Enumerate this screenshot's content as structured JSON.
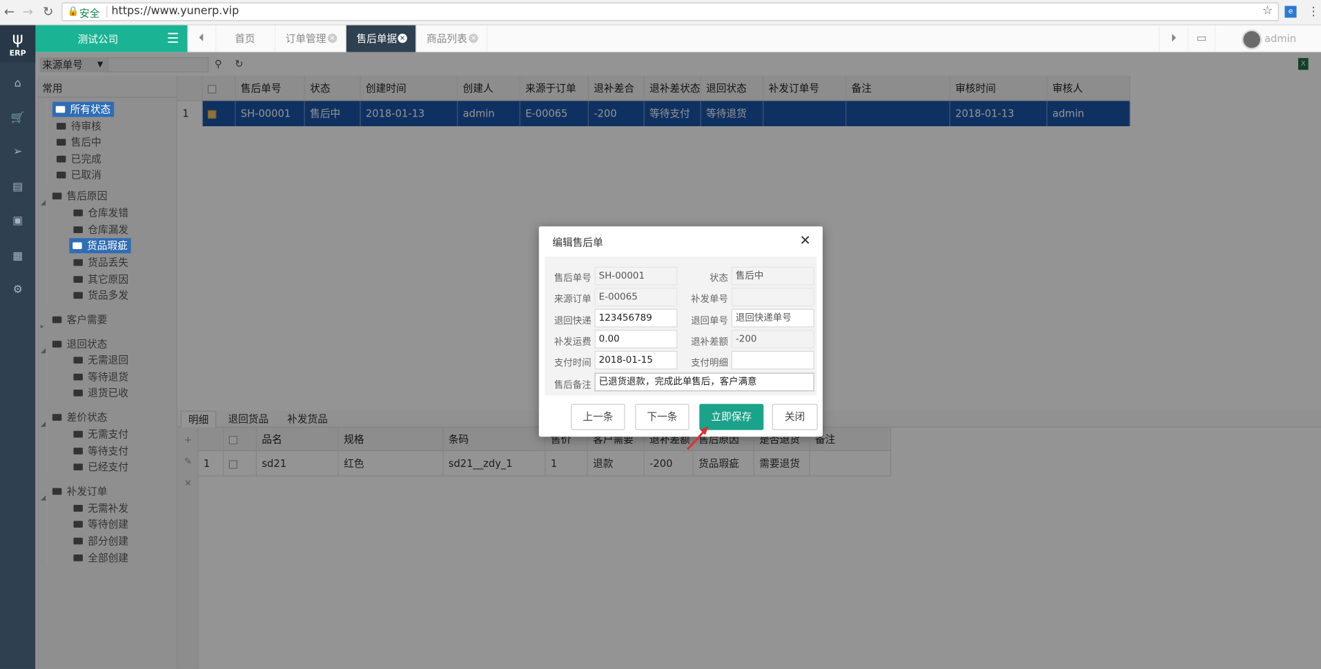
{
  "browser": {
    "secure_label": "安全",
    "url": "https://www.yunerp.vip"
  },
  "app": {
    "logo_text": "ERP",
    "company": "测试公司",
    "user": "admin"
  },
  "tabs": [
    {
      "label": "首页"
    },
    {
      "label": "订单管理"
    },
    {
      "label": "售后单据",
      "active": true
    },
    {
      "label": "商品列表"
    }
  ],
  "filter": {
    "select_value": "来源单号"
  },
  "tree": {
    "header": "常用",
    "groups": [
      {
        "label": "所有状态",
        "children": [
          "待审核",
          "售后中",
          "已完成",
          "已取消"
        ]
      },
      {
        "label": "售后原因",
        "children": [
          "仓库发错",
          "仓库漏发",
          "货品瑕疵",
          "货品丢失",
          "其它原因",
          "货品多发"
        ]
      },
      {
        "label": "客户需要",
        "children": []
      },
      {
        "label": "退回状态",
        "children": [
          "无需退回",
          "等待退货",
          "退货已收"
        ]
      },
      {
        "label": "差价状态",
        "children": [
          "无需支付",
          "等待支付",
          "已经支付"
        ]
      },
      {
        "label": "补发订单",
        "children": [
          "无需补发",
          "等待创建",
          "部分创建",
          "全部创建"
        ]
      }
    ]
  },
  "grid": {
    "columns": [
      "售后单号",
      "状态",
      "创建时间",
      "创建人",
      "来源于订单",
      "退补差合计",
      "退补差状态",
      "退回状态",
      "补发订单号",
      "备注",
      "审核时间",
      "审核人"
    ],
    "row": {
      "no": "1",
      "cells": [
        "SH-00001",
        "售后中",
        "2018-01-13 14:36:09",
        "admin",
        "E-00065",
        "-200",
        "等待支付",
        "等待退货",
        "",
        "",
        "2018-01-13 14:36:09",
        "admin"
      ]
    }
  },
  "bottom_tabs": [
    "明细",
    "退回货品",
    "补发货品"
  ],
  "detail": {
    "columns": [
      "品名",
      "规格",
      "条码",
      "售价",
      "客户需要",
      "退补差额",
      "售后原因",
      "是否退货",
      "备注"
    ],
    "row": {
      "no": "1",
      "cells": [
        "sd21",
        "红色",
        "sd21__zdy_1",
        "1",
        "退款",
        "-200",
        "货品瑕疵",
        "需要退货",
        ""
      ]
    }
  },
  "modal": {
    "title": "编辑售后单",
    "fields": {
      "sh_no_label": "售后单号",
      "sh_no": "SH-00001",
      "status_label": "状态",
      "status": "售后中",
      "src_label": "来源订单",
      "src": "E-00065",
      "reissue_label": "补发单号",
      "reissue": "",
      "ret_express_label": "退回快递",
      "ret_express": "123456789",
      "ret_no_label": "退回单号",
      "ret_no_placeholder": "退回快递单号",
      "freight_label": "补发运费",
      "freight": "0.00",
      "diff_label": "退补差额",
      "diff": "-200",
      "paytime_label": "支付时间",
      "paytime": "2018-01-15",
      "paydetail_label": "支付明细",
      "paydetail": "",
      "remark_label": "售后备注",
      "remark": "已退货退款，完成此单售后，客户满意"
    },
    "buttons": {
      "prev": "上一条",
      "next": "下一条",
      "save": "立即保存",
      "close": "关闭"
    }
  },
  "colors": {
    "accent": "#1ab394",
    "selected_row": "#1a55a8",
    "sidebar": "#2f4050",
    "save": "#1aa38a",
    "arrow": "#e03030"
  }
}
